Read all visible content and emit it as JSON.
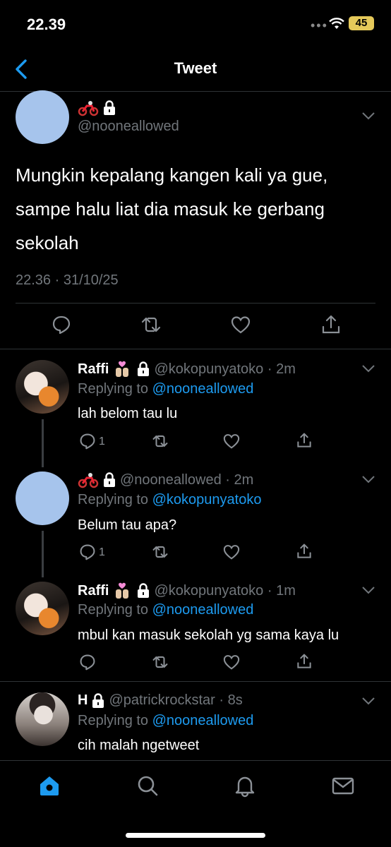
{
  "status": {
    "time": "22.39",
    "battery": "45"
  },
  "nav": {
    "title": "Tweet"
  },
  "main_tweet": {
    "handle": "@nooneallowed",
    "text": "Mungkin kepalang kangen kali ya gue, sampe halu liat dia masuk ke gerbang sekolah",
    "timestamp": "22.36 · 31/10/25"
  },
  "replies": [
    {
      "name": "Raffi",
      "handle": "@kokopunyatoko",
      "time": "2m",
      "replying_prefix": "Replying to ",
      "replying_to": "@nooneallowed",
      "text": "lah belom tau lu",
      "reply_count": "1"
    },
    {
      "name": "",
      "handle": "@nooneallowed",
      "time": "2m",
      "replying_prefix": "Replying to ",
      "replying_to": "@kokopunyatoko",
      "text": "Belum tau apa?",
      "reply_count": "1"
    },
    {
      "name": "Raffi",
      "handle": "@kokopunyatoko",
      "time": "1m",
      "replying_prefix": "Replying to ",
      "replying_to": "@nooneallowed",
      "text": "mbul kan masuk sekolah yg sama kaya lu",
      "reply_count": ""
    },
    {
      "name": "H",
      "handle": "@patrickrockstar",
      "time": "8s",
      "replying_prefix": "Replying to ",
      "replying_to": "@nooneallowed",
      "text": "cih malah ngetweet",
      "reply_count": ""
    }
  ],
  "icons": {
    "back": "chevron-left-icon",
    "reply": "speech-bubble-icon",
    "retweet": "retweet-icon",
    "like": "heart-icon",
    "share": "share-icon",
    "home": "home-icon",
    "search": "search-icon",
    "notifications": "bell-icon",
    "messages": "envelope-icon"
  },
  "colors": {
    "accent": "#1d9bf0",
    "muted": "#71767b",
    "background": "#000000"
  }
}
